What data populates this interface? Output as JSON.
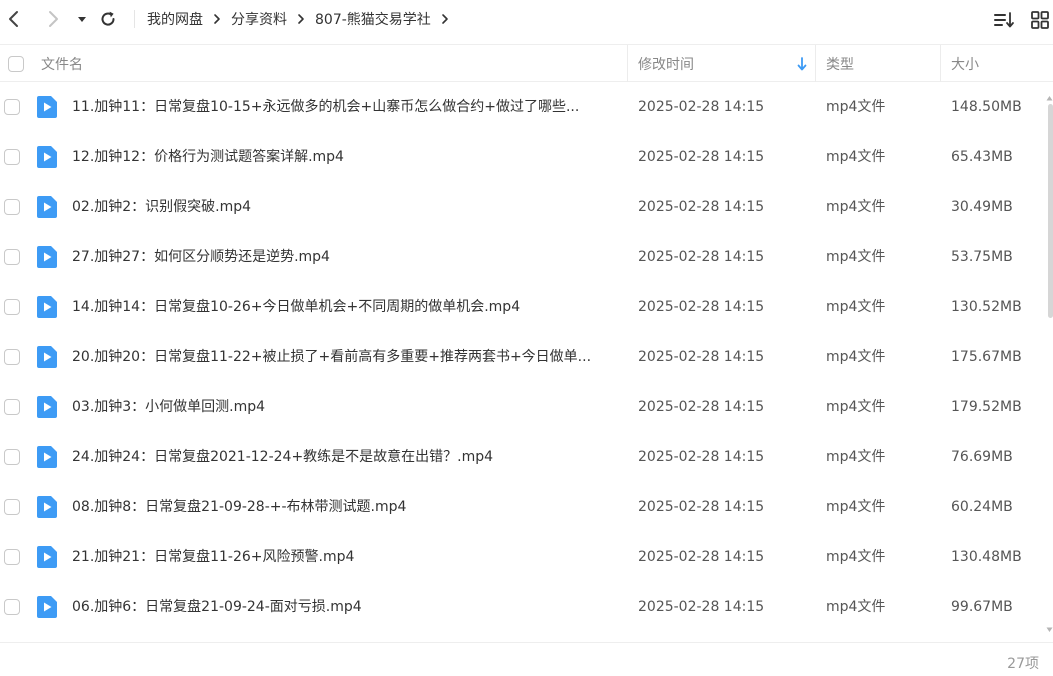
{
  "toolbar": {
    "breadcrumb": [
      "我的网盘",
      "分享资料",
      "807-熊猫交易学社"
    ]
  },
  "columns": {
    "name": "文件名",
    "modified": "修改时间",
    "type": "类型",
    "size": "大小"
  },
  "files": [
    {
      "name": "11.加钟11：日常复盘10-15+永远做多的机会+山寨币怎么做合约+做过了哪些...",
      "modified": "2025-02-28 14:15",
      "type": "mp4文件",
      "size": "148.50MB"
    },
    {
      "name": "12.加钟12：价格行为测试题答案详解.mp4",
      "modified": "2025-02-28 14:15",
      "type": "mp4文件",
      "size": "65.43MB"
    },
    {
      "name": "02.加钟2：识别假突破.mp4",
      "modified": "2025-02-28 14:15",
      "type": "mp4文件",
      "size": "30.49MB"
    },
    {
      "name": "27.加钟27：如何区分顺势还是逆势.mp4",
      "modified": "2025-02-28 14:15",
      "type": "mp4文件",
      "size": "53.75MB"
    },
    {
      "name": "14.加钟14：日常复盘10-26+今日做单机会+不同周期的做单机会.mp4",
      "modified": "2025-02-28 14:15",
      "type": "mp4文件",
      "size": "130.52MB"
    },
    {
      "name": "20.加钟20：日常复盘11-22+被止损了+看前高有多重要+推荐两套书+今日做单...",
      "modified": "2025-02-28 14:15",
      "type": "mp4文件",
      "size": "175.67MB"
    },
    {
      "name": "03.加钟3：小何做单回测.mp4",
      "modified": "2025-02-28 14:15",
      "type": "mp4文件",
      "size": "179.52MB"
    },
    {
      "name": "24.加钟24：日常复盘2021-12-24+教练是不是故意在出错？.mp4",
      "modified": "2025-02-28 14:15",
      "type": "mp4文件",
      "size": "76.69MB"
    },
    {
      "name": "08.加钟8：日常复盘21-09-28-+-布林带测试题.mp4",
      "modified": "2025-02-28 14:15",
      "type": "mp4文件",
      "size": "60.24MB"
    },
    {
      "name": "21.加钟21：日常复盘11-26+风险预警.mp4",
      "modified": "2025-02-28 14:15",
      "type": "mp4文件",
      "size": "130.48MB"
    },
    {
      "name": "06.加钟6：日常复盘21-09-24-面对亏损.mp4",
      "modified": "2025-02-28 14:15",
      "type": "mp4文件",
      "size": "99.67MB"
    }
  ],
  "footer": {
    "count": "27项"
  },
  "colors": {
    "file_icon": "#3d9bf5",
    "sort_arrow": "#3d9bf5"
  }
}
